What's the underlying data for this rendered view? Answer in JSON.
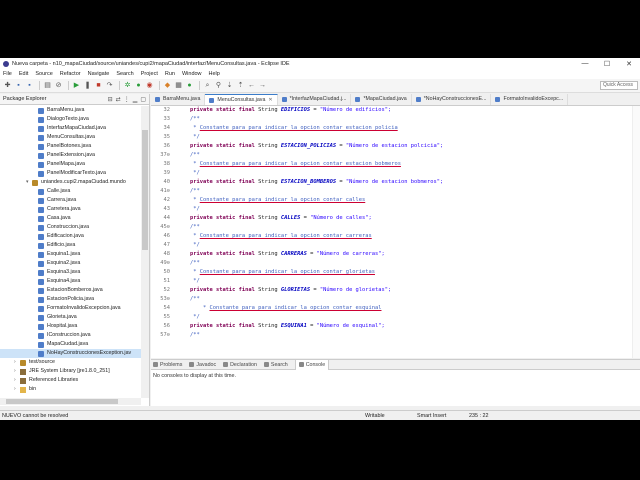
{
  "window": {
    "title": "Nueva carpeta - n10_mapaCiudad/source/uniandes/cupi2/mapaCiudad/interfaz/MenuConsultas.java - Eclipse IDE",
    "minimize": "—",
    "maximize": "☐",
    "close": "✕"
  },
  "menu": [
    "File",
    "Edit",
    "Source",
    "Refactor",
    "Navigate",
    "Search",
    "Project",
    "Run",
    "Window",
    "Help"
  ],
  "quick_access": "Quick Access",
  "explorer": {
    "title": "Package Explorer",
    "items": [
      {
        "label": "BarraMenu.java",
        "type": "j",
        "indent": 38
      },
      {
        "label": "DialogoTexto.java",
        "type": "j",
        "indent": 38
      },
      {
        "label": "InterfazMapaCiudad.java",
        "type": "j",
        "indent": 38
      },
      {
        "label": "MenuConsultas.java",
        "type": "j",
        "indent": 38
      },
      {
        "label": "PanelBotones.java",
        "type": "j",
        "indent": 38
      },
      {
        "label": "PanelExtension.java",
        "type": "j",
        "indent": 38
      },
      {
        "label": "PanelMapa.java",
        "type": "j",
        "indent": 38
      },
      {
        "label": "PanelModificarTexto.java",
        "type": "j",
        "indent": 38
      },
      {
        "label": "uniandes.cupi2.mapaCiudad.mundo",
        "type": "pkg",
        "indent": 26,
        "arrow": "▾"
      },
      {
        "label": "Calle.java",
        "type": "j",
        "indent": 38
      },
      {
        "label": "Carrera.java",
        "type": "j",
        "indent": 38
      },
      {
        "label": "Carretera.java",
        "type": "j",
        "indent": 38
      },
      {
        "label": "Casa.java",
        "type": "j",
        "indent": 38
      },
      {
        "label": "Construccion.java",
        "type": "j",
        "indent": 38
      },
      {
        "label": "Edificacion.java",
        "type": "j",
        "indent": 38
      },
      {
        "label": "Edificio.java",
        "type": "j",
        "indent": 38
      },
      {
        "label": "Esquina1.java",
        "type": "j",
        "indent": 38
      },
      {
        "label": "Esquina2.java",
        "type": "j",
        "indent": 38
      },
      {
        "label": "Esquina3.java",
        "type": "j",
        "indent": 38
      },
      {
        "label": "Esquina4.java",
        "type": "j",
        "indent": 38
      },
      {
        "label": "EstacionBomberos.java",
        "type": "j",
        "indent": 38
      },
      {
        "label": "EstacionPolicia.java",
        "type": "j",
        "indent": 38
      },
      {
        "label": "FormatoInvalidoExcepcion.java",
        "type": "j",
        "indent": 38
      },
      {
        "label": "Glorieta.java",
        "type": "j",
        "indent": 38
      },
      {
        "label": "Hospital.java",
        "type": "j",
        "indent": 38
      },
      {
        "label": "IConstruccion.java",
        "type": "j",
        "indent": 38
      },
      {
        "label": "MapaCiudad.java",
        "type": "j",
        "indent": 38
      },
      {
        "label": "NoHayConstruccionesException.jav",
        "type": "j",
        "indent": 38,
        "selected": true
      },
      {
        "label": "test/source",
        "type": "pkg",
        "indent": 14,
        "arrow": "›"
      },
      {
        "label": "JRE System Library [jre1.8.0_251]",
        "type": "lib",
        "indent": 14,
        "arrow": "›"
      },
      {
        "label": "Referenced Libraries",
        "type": "lib",
        "indent": 14,
        "arrow": "›"
      },
      {
        "label": "bin",
        "type": "fold",
        "indent": 14,
        "arrow": "›"
      }
    ]
  },
  "editor": {
    "tabs": [
      {
        "label": "BarraMenu.java",
        "active": false
      },
      {
        "label": "MenuConsultas.java",
        "active": true
      },
      {
        "label": "*InterfazMapaCiudad.j...",
        "active": false
      },
      {
        "label": "*MapaCiudad.java",
        "active": false
      },
      {
        "label": "*NoHayConstruccionesE...",
        "active": false
      },
      {
        "label": "FormatoInvalidoExcepc...",
        "active": false
      }
    ],
    "lines": [
      {
        "n": "32",
        "kind": "field",
        "name": "EDIFICIOS",
        "value": "\"Número de edificios\";"
      },
      {
        "n": "33",
        "kind": "cstart"
      },
      {
        "n": "34",
        "kind": "comment",
        "pre": "     * ",
        "text": "Constante para para indicar la opcion contar estacion policia"
      },
      {
        "n": "35",
        "kind": "cend"
      },
      {
        "n": "36",
        "kind": "field",
        "name": "ESTACION_POLICIAS",
        "value": "\"Número de estacion polcicia\";"
      },
      {
        "n": "37",
        "kind": "cstart",
        "fold": "⊖"
      },
      {
        "n": "38",
        "kind": "comment",
        "pre": "     * ",
        "text": "Constante para para indicar la opcion contar estacion bobmeros"
      },
      {
        "n": "39",
        "kind": "cend"
      },
      {
        "n": "40",
        "kind": "field",
        "name": "ESTACION_BOMBEROS",
        "value": "\"Número de estacion bobmeros\";"
      },
      {
        "n": "41",
        "kind": "cstart",
        "fold": "⊖"
      },
      {
        "n": "42",
        "kind": "comment",
        "pre": "     * ",
        "text": "Constante para para indicar la opcion contar calles"
      },
      {
        "n": "43",
        "kind": "cend"
      },
      {
        "n": "44",
        "kind": "field",
        "name": "CALLES",
        "value": "\"Número de calles\";"
      },
      {
        "n": "45",
        "kind": "cstart",
        "fold": "⊖"
      },
      {
        "n": "46",
        "kind": "comment",
        "pre": "     * ",
        "text": "Constante para para indicar la opcion contar carreras"
      },
      {
        "n": "47",
        "kind": "cend"
      },
      {
        "n": "48",
        "kind": "field",
        "name": "CARRERAS",
        "value": "\"Número de carreras\";"
      },
      {
        "n": "49",
        "kind": "cstart",
        "fold": "⊖"
      },
      {
        "n": "50",
        "kind": "comment",
        "pre": "     * ",
        "text": "Constante para para indicar la opcion contar glorietas"
      },
      {
        "n": "51",
        "kind": "cend"
      },
      {
        "n": "52",
        "kind": "field",
        "name": "GLORIETAS",
        "value": "\"Número de glorietas\";"
      },
      {
        "n": "53",
        "kind": "cstart",
        "fold": "⊖"
      },
      {
        "n": "54",
        "kind": "comment",
        "pre": "        * ",
        "text": "Constante para para indicar la opcion contar esquinal"
      },
      {
        "n": "55",
        "kind": "cend"
      },
      {
        "n": "56",
        "kind": "field",
        "name": "ESQUINA1",
        "value": "\"Número de esquinal\";"
      },
      {
        "n": "57",
        "kind": "cstart",
        "fold": "⊖"
      }
    ],
    "keywords": "private static final",
    "type": "String"
  },
  "console": {
    "tabs": [
      "Problems",
      "Javadoc",
      "Declaration",
      "Search",
      "Console"
    ],
    "active": "Console",
    "message": "No consoles to display at this time."
  },
  "status": {
    "message": "NUEVO cannot be resolved",
    "writable": "Writable",
    "insert": "Smart Insert",
    "position": "235 : 22"
  }
}
